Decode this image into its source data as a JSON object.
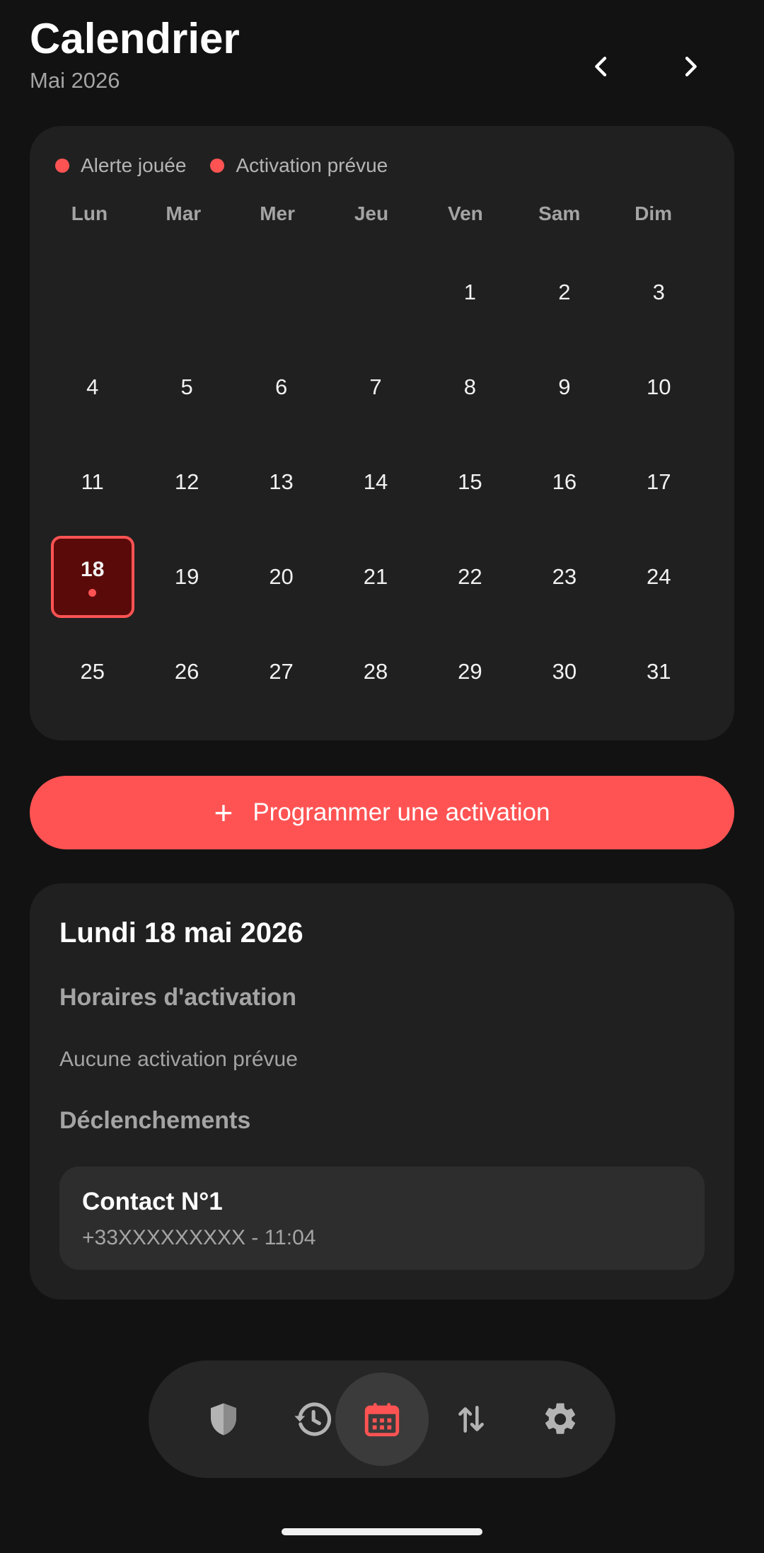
{
  "header": {
    "title": "Calendrier",
    "month": "Mai 2026"
  },
  "legend": [
    {
      "label": "Alerte jouée",
      "color": "#ff5353"
    },
    {
      "label": "Activation prévue",
      "color": "#ff5353"
    }
  ],
  "weekdays": [
    "Lun",
    "Mar",
    "Mer",
    "Jeu",
    "Ven",
    "Sam",
    "Dim"
  ],
  "calendar": {
    "leading_blanks": 4,
    "days": [
      "1",
      "2",
      "3",
      "4",
      "5",
      "6",
      "7",
      "8",
      "9",
      "10",
      "11",
      "12",
      "13",
      "14",
      "15",
      "16",
      "17",
      "18",
      "19",
      "20",
      "21",
      "22",
      "23",
      "24",
      "25",
      "26",
      "27",
      "28",
      "29",
      "30",
      "31"
    ],
    "selected_day": "18",
    "days_with_marker": [
      "18"
    ]
  },
  "cta": {
    "label": "Programmer une activation",
    "icon": "plus-icon"
  },
  "detail": {
    "date": "Lundi 18 mai 2026",
    "schedule_heading": "Horaires d'activation",
    "schedule_empty": "Aucune activation prévue",
    "triggers_heading": "Déclenchements",
    "triggers": [
      {
        "name": "Contact N°1",
        "info": "+33XXXXXXXXX - 11:04"
      }
    ]
  },
  "bottom_nav": [
    {
      "icon": "shield-icon",
      "active": false
    },
    {
      "icon": "history-icon",
      "active": false
    },
    {
      "icon": "calendar-icon",
      "active": true
    },
    {
      "icon": "swap-vertical-icon",
      "active": false
    },
    {
      "icon": "gear-icon",
      "active": false
    }
  ],
  "colors": {
    "accent": "#ff5353",
    "background": "#121212",
    "card": "#202020",
    "selected_day_bg": "#5b0a0a"
  }
}
